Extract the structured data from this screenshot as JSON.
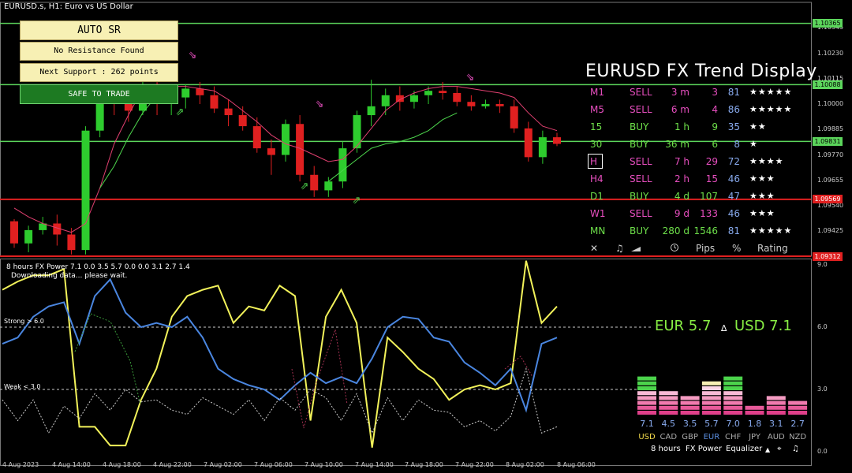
{
  "chart_title": "EURUSD.s, H1:  Euro vs US Dollar",
  "auto_sr": {
    "title": "AUTO SR",
    "resistance": "No Resistance Found",
    "support": "Next Support : 262 points",
    "status": "SAFE TO TRADE"
  },
  "trend_display": {
    "title": "EURUSD FX Trend Display",
    "rows": [
      {
        "tf": "M1",
        "dir": "SELL",
        "dur": "3 m",
        "pips": "3",
        "pct": "81",
        "stars": "★★★★★",
        "color": "#e84fc0"
      },
      {
        "tf": "M5",
        "dir": "SELL",
        "dur": "6 m",
        "pips": "4",
        "pct": "86",
        "stars": "★★★★★",
        "color": "#e84fc0"
      },
      {
        "tf": "15",
        "dir": "BUY",
        "dur": "1 h",
        "pips": "9",
        "pct": "35",
        "stars": "★★",
        "color": "#6ee04a"
      },
      {
        "tf": "30",
        "dir": "BUY",
        "dur": "36 m",
        "pips": "6",
        "pct": "8",
        "stars": "★",
        "color": "#6ee04a"
      },
      {
        "tf": "H",
        "dir": "SELL",
        "dur": "7 h",
        "pips": "29",
        "pct": "72",
        "stars": "★★★★",
        "color": "#e84fc0"
      },
      {
        "tf": "H4",
        "dir": "SELL",
        "dur": "2 h",
        "pips": "15",
        "pct": "46",
        "stars": "★★★",
        "color": "#e84fc0"
      },
      {
        "tf": "D1",
        "dir": "BUY",
        "dur": "4 d",
        "pips": "107",
        "pct": "47",
        "stars": "★★★",
        "color": "#6ee04a"
      },
      {
        "tf": "W1",
        "dir": "SELL",
        "dur": "9 d",
        "pips": "133",
        "pct": "46",
        "stars": "★★★",
        "color": "#e84fc0"
      },
      {
        "tf": "MN",
        "dir": "BUY",
        "dur": "280 d",
        "pips": "1546",
        "pct": "81",
        "stars": "★★★★★",
        "color": "#6ee04a"
      }
    ],
    "footer": {
      "close": "✕",
      "sound": "♫",
      "pips": "Pips",
      "pct": "%",
      "rating": "Rating"
    }
  },
  "price_axis": {
    "ticks": [
      "1.10345",
      "1.10230",
      "1.10115",
      "1.10000",
      "1.09885",
      "1.09770",
      "1.09655",
      "1.09540",
      "1.09425"
    ],
    "tags": [
      {
        "label": "1.10365",
        "color": "#5cd65c"
      },
      {
        "label": "1.10088",
        "color": "#5cd65c"
      },
      {
        "label": "1.09831",
        "color": "#5cd65c"
      },
      {
        "label": "1.09569",
        "color": "#e02020"
      },
      {
        "label": "1.09312",
        "color": "#e02020"
      }
    ]
  },
  "sub_axis": {
    "ticks": [
      "9.0",
      "6.0",
      "3.0",
      "0.0"
    ]
  },
  "time_axis": [
    "4 Aug 2023",
    "4 Aug 14:00",
    "4 Aug 18:00",
    "4 Aug 22:00",
    "7 Aug 02:00",
    "7 Aug 06:00",
    "7 Aug 10:00",
    "7 Aug 14:00",
    "7 Aug 18:00",
    "7 Aug 22:00",
    "8 Aug 02:00",
    "8 Aug 06:00"
  ],
  "fx_power": {
    "title": "8 hours FX Power 7.1 0.0 3.5 5.7 0.0 0.0 3.1 2.7 1.4",
    "message": "Downloading data... please wait.",
    "strong_label": "Strong > 6.0",
    "weak_label": "Weak < 3.0",
    "heading_left": "EUR 5.7",
    "heading_sep": "∆",
    "heading_right": "USD 7.1",
    "equalizer": {
      "currencies": [
        "USD",
        "CAD",
        "GBP",
        "EUR",
        "CHF",
        "JPY",
        "AUD",
        "NZD"
      ],
      "values": [
        7.1,
        4.5,
        3.5,
        5.7,
        7.0,
        1.8,
        3.1,
        2.7
      ],
      "labels": [
        "7.1",
        "4.5",
        "3.5",
        "5.7",
        "7.0",
        "1.8",
        "3.1",
        "2.7"
      ],
      "cur_colors": [
        "#f0d84a",
        "#aaaaaa",
        "#aaaaaa",
        "#5b8fe0",
        "#aaaaaa",
        "#aaaaaa",
        "#aaaaaa",
        "#aaaaaa"
      ]
    },
    "footer": {
      "hours": "8 hours",
      "power": "FX Power",
      "eq": "Equalizer",
      "up": "▲",
      "target": "⌖",
      "note": "♫"
    }
  },
  "chart_data": [
    {
      "type": "candlestick",
      "title": "EURUSD.s, H1:  Euro vs US Dollar",
      "ylim": [
        1.09312,
        1.1046
      ],
      "x": [
        "4 Aug 2023",
        "4 Aug 14:00",
        "4 Aug 18:00",
        "4 Aug 22:00",
        "7 Aug 02:00",
        "7 Aug 06:00",
        "7 Aug 10:00",
        "7 Aug 14:00",
        "7 Aug 18:00",
        "7 Aug 22:00",
        "8 Aug 02:00",
        "8 Aug 06:00"
      ],
      "candles": [
        [
          1.0947,
          1.0948,
          1.0935,
          1.0937
        ],
        [
          1.0937,
          1.0945,
          1.0933,
          1.0943
        ],
        [
          1.0943,
          1.0949,
          1.0941,
          1.0946
        ],
        [
          1.0946,
          1.095,
          1.0936,
          1.0941
        ],
        [
          1.0941,
          1.0944,
          1.0932,
          1.0934
        ],
        [
          1.0934,
          1.099,
          1.0932,
          1.0988
        ],
        [
          1.0988,
          1.1006,
          1.0985,
          1.1003
        ],
        [
          1.1003,
          1.1008,
          1.0995,
          1.1001
        ],
        [
          1.1001,
          1.1006,
          1.0992,
          1.0997
        ],
        [
          1.0997,
          1.101,
          1.0995,
          1.1008
        ],
        [
          1.1008,
          1.1012,
          1.0995,
          1.1001
        ],
        [
          1.1001,
          1.1005,
          1.0995,
          1.1003
        ],
        [
          1.1003,
          1.1009,
          1.0998,
          1.1007
        ],
        [
          1.1007,
          1.101,
          1.1,
          1.1004
        ],
        [
          1.1004,
          1.1008,
          1.0996,
          1.0998
        ],
        [
          1.0998,
          1.1002,
          1.099,
          1.0995
        ],
        [
          1.0995,
          1.0999,
          1.0988,
          1.099
        ],
        [
          1.099,
          1.0994,
          1.0978,
          1.098
        ],
        [
          1.098,
          1.0984,
          1.0968,
          1.0977
        ],
        [
          1.0977,
          1.0993,
          1.0974,
          1.0991
        ],
        [
          1.0991,
          1.0995,
          1.0965,
          1.0968
        ],
        [
          1.0968,
          1.0972,
          1.0958,
          1.0961
        ],
        [
          1.0961,
          1.0967,
          1.0958,
          1.0965
        ],
        [
          1.0965,
          1.0983,
          1.0962,
          1.098
        ],
        [
          1.098,
          1.0997,
          1.0978,
          1.0995
        ],
        [
          1.0995,
          1.1011,
          1.099,
          1.0999
        ],
        [
          1.0999,
          1.1007,
          1.0995,
          1.1004
        ],
        [
          1.1004,
          1.1008,
          1.0997,
          1.1001
        ],
        [
          1.1001,
          1.1006,
          1.0998,
          1.1004
        ],
        [
          1.1004,
          1.1008,
          1.1,
          1.1006
        ],
        [
          1.1006,
          1.101,
          1.1002,
          1.1005
        ],
        [
          1.1005,
          1.1008,
          1.0999,
          1.1001
        ],
        [
          1.1001,
          1.1004,
          1.0997,
          1.0999
        ],
        [
          1.0999,
          1.1002,
          1.0998,
          1.1
        ],
        [
          1.1,
          1.1002,
          1.0996,
          1.0999
        ],
        [
          1.0999,
          1.1002,
          1.0987,
          1.0989
        ],
        [
          1.0989,
          1.0992,
          1.0974,
          1.0976
        ],
        [
          1.0976,
          1.0988,
          1.0973,
          1.0985
        ],
        [
          1.0985,
          1.0987,
          1.0981,
          1.0982
        ]
      ],
      "series": [
        {
          "name": "ma-red",
          "values": [
            1.0953,
            1.0949,
            1.0946,
            1.0944,
            1.0942,
            1.0946,
            1.0962,
            1.0982,
            1.0995,
            1.1007,
            1.1009,
            1.1008,
            1.1008,
            1.1007,
            1.1006,
            1.1002,
            1.0997,
            1.0992,
            1.0986,
            1.0982,
            1.098,
            1.0977,
            1.0974,
            1.0975,
            1.0981,
            1.0989,
            1.0997,
            1.1002,
            1.1005,
            1.1007,
            1.1008,
            1.1008,
            1.1007,
            1.1006,
            1.1005,
            1.1003,
            1.0996,
            1.099,
            1.0988
          ]
        },
        {
          "name": "ma-green",
          "values": [
            null,
            null,
            null,
            null,
            null,
            null,
            1.0962,
            1.0972,
            1.0985,
            1.0996,
            1.1004,
            null,
            null,
            null,
            null,
            null,
            null,
            null,
            null,
            null,
            null,
            null,
            1.0965,
            1.097,
            1.0975,
            1.098,
            1.0982,
            1.0983,
            1.0985,
            1.0988,
            1.0993,
            1.0996,
            null,
            null,
            null,
            null,
            null,
            null,
            null
          ]
        }
      ]
    },
    {
      "type": "line",
      "title": "8 hours FX Power 7.1 0.0 3.5 5.7 0.0 0.0 3.1 2.7 1.4",
      "ylim": [
        0,
        9
      ],
      "series": [
        {
          "name": "USD",
          "values": [
            7.8,
            8.2,
            8.5,
            8.5,
            8.8,
            1.2,
            1.2,
            0.3,
            0.3,
            2.5,
            4.0,
            6.5,
            7.5,
            7.8,
            8.0,
            6.2,
            7.0,
            6.8,
            8.0,
            7.5,
            1.5,
            6.5,
            7.8,
            6.2,
            0.2,
            5.5,
            4.8,
            4.0,
            3.5,
            2.5,
            3.0,
            3.2,
            3.0,
            3.3,
            9.2,
            6.2,
            7.0
          ]
        },
        {
          "name": "EUR",
          "values": [
            5.2,
            5.5,
            6.5,
            7.0,
            7.2,
            5.2,
            7.5,
            8.3,
            6.7,
            6.0,
            6.2,
            6.0,
            6.5,
            5.5,
            4.0,
            3.5,
            3.2,
            3.0,
            2.5,
            3.2,
            3.8,
            3.3,
            3.6,
            3.3,
            4.5,
            6.0,
            6.5,
            6.4,
            5.5,
            5.3,
            4.3,
            3.8,
            3.2,
            4.0,
            2.0,
            5.2,
            5.5
          ]
        },
        {
          "name": "ref-dashed-white",
          "values": [
            2.5,
            1.5,
            2.5,
            0.9,
            2.2,
            1.6,
            2.8,
            2.0,
            3.0,
            2.4,
            2.5,
            2.0,
            1.8,
            2.6,
            2.2,
            1.8,
            2.5,
            1.5,
            2.6,
            2.0,
            3.0,
            2.6,
            1.5,
            2.8,
            0.9,
            2.6,
            1.5,
            2.5,
            2.0,
            1.9,
            1.2,
            1.5,
            1.0,
            1.7,
            4.0,
            0.9,
            1.2
          ]
        }
      ]
    },
    {
      "type": "bar",
      "title": "FX Power Equalizer",
      "categories": [
        "USD",
        "CAD",
        "GBP",
        "EUR",
        "CHF",
        "JPY",
        "AUD",
        "NZD"
      ],
      "values": [
        7.1,
        4.5,
        3.5,
        5.7,
        7.0,
        1.8,
        3.1,
        2.7
      ]
    }
  ]
}
